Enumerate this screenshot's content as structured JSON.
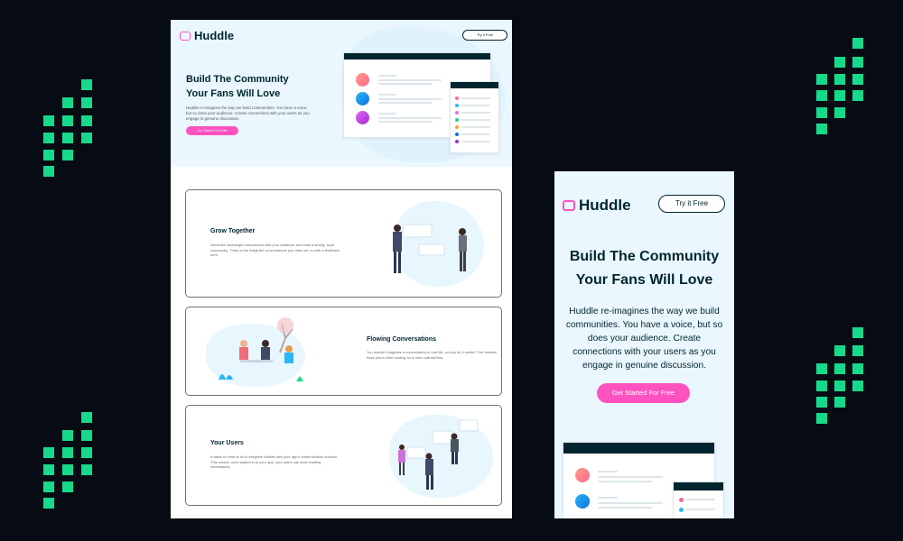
{
  "colors": {
    "background": "#070b14",
    "pixel_accent": "#17d98b",
    "brand_pink": "#ff52c1",
    "brand_navy": "#00252e",
    "hero_bg": "#eaf7fe"
  },
  "desktop": {
    "brand": "Huddle",
    "try_label": "Try it Free",
    "hero_title_1": "Build The Community",
    "hero_title_2": "Your Fans Will Love",
    "hero_desc": "Huddle re-imagines the way we build communities. You have a voice, but so does your audience. Create connections with your users as you engage in genuine discussion.",
    "cta_label": "Get Started For Free",
    "features": [
      {
        "title": "Grow Together",
        "text": "Generate meaningful discussions with your audience and build a strong, loyal community. Think of the insightful conversations you miss out on with a feedback form."
      },
      {
        "title": "Flowing Conversations",
        "text": "You wouldn't paginate a conversation in real life, so why do it online? Our threads have just-in-time loading for a more natural flow."
      },
      {
        "title": "Your Users",
        "text": "It takes no time at all to integrate Huddle with your app's authentication solution. This means, once signed in to your app, your users can start chatting immediately."
      }
    ]
  },
  "mobile": {
    "brand": "Huddle",
    "try_label": "Try it Free",
    "hero_title_1": "Build The Community",
    "hero_title_2": "Your Fans Will Love",
    "hero_desc": "Huddle re-imagines the way we build communities. You have a voice, but so does your audience. Create connections with your users as you engage in genuine discussion.",
    "cta_label": "Get Started For Free"
  }
}
